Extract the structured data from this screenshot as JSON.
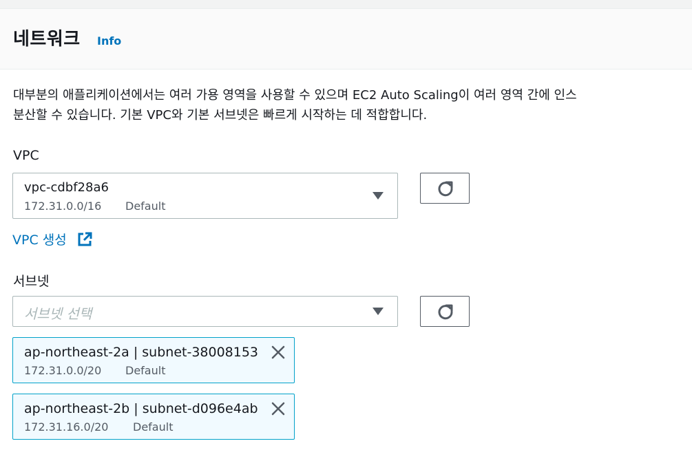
{
  "section": {
    "title": "네트워크",
    "info_link": "Info",
    "description_line1": "대부분의 애플리케이션에서는 여러 가용 영역을 사용할 수 있으며 EC2 Auto Scaling이 여러 영역 간에 인스",
    "description_line2": "분산할 수 있습니다. 기본 VPC와 기본 서브넷은 빠르게 시작하는 데 적합합니다."
  },
  "vpc": {
    "label": "VPC",
    "selected_id": "vpc-cdbf28a6",
    "selected_cidr": "172.31.0.0/16",
    "selected_tag": "Default",
    "create_link": "VPC 생성"
  },
  "subnet": {
    "label": "서브넷",
    "placeholder": "서브넷 선택",
    "tokens": [
      {
        "name": "ap-northeast-2a | subnet-38008153",
        "cidr": "172.31.0.0/20",
        "tag": "Default"
      },
      {
        "name": "ap-northeast-2b | subnet-d096e4ab",
        "cidr": "172.31.16.0/20",
        "tag": "Default"
      }
    ]
  },
  "icons": {
    "dropdown": "caret-down-icon",
    "refresh": "refresh-icon",
    "external": "external-link-icon",
    "remove": "close-icon"
  },
  "colors": {
    "link": "#0073bb",
    "token_border": "#00a1c9",
    "token_bg": "#f1faff"
  }
}
